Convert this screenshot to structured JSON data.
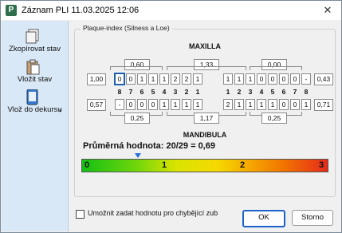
{
  "window": {
    "title": "Záznam PLI 11.03.2025 12:06",
    "close_glyph": "✕",
    "app_icon_letter": "P"
  },
  "sidebar": {
    "items": [
      {
        "label": "Zkopírovat stav",
        "icon": "copy-icon"
      },
      {
        "label": "Vložit stav",
        "icon": "paste-icon"
      },
      {
        "label": "Vlož do dekursu",
        "icon": "phone-paste-icon"
      }
    ]
  },
  "group_label": "Plaque-index (Silness a Loe)",
  "maxilla": {
    "title": "MAXILLA",
    "quadrant_avgs": [
      "0,60",
      "1,33",
      "0,00"
    ],
    "left_value": "1,00",
    "right_value": "0,43",
    "cells": [
      "0",
      "0",
      "1",
      "1",
      "1",
      "2",
      "2",
      "1",
      "",
      "1",
      "1",
      "1",
      "0",
      "0",
      "0",
      "0",
      "-"
    ]
  },
  "tooth_numbers": [
    "8",
    "7",
    "6",
    "5",
    "4",
    "3",
    "2",
    "1",
    "1",
    "2",
    "3",
    "4",
    "5",
    "6",
    "7",
    "8"
  ],
  "mandibula": {
    "title": "MANDIBULA",
    "quadrant_avgs": [
      "0,25",
      "1,17",
      "0,25"
    ],
    "left_value": "0,57",
    "right_value": "0,71",
    "cells": [
      "-",
      "0",
      "0",
      "0",
      "1",
      "1",
      "1",
      "1",
      "",
      "2",
      "1",
      "1",
      "1",
      "1",
      "0",
      "0",
      "1"
    ]
  },
  "summary": {
    "text": "Průměrná hodnota: 20/29 = 0,69",
    "value": 0.69
  },
  "scale": {
    "labels": [
      "0",
      "1",
      "2",
      "3"
    ],
    "min": 0,
    "max": 3
  },
  "checkbox": {
    "label": "Umožnit zadat hodnotu pro chybějící zub",
    "checked": false
  },
  "buttons": {
    "ok": "OK",
    "cancel": "Storno"
  },
  "colors": {
    "sidebar_bg": "#d9e8f6",
    "accent": "#1c63c9",
    "scale_start": "#13c013",
    "scale_end": "#e52a1a"
  }
}
